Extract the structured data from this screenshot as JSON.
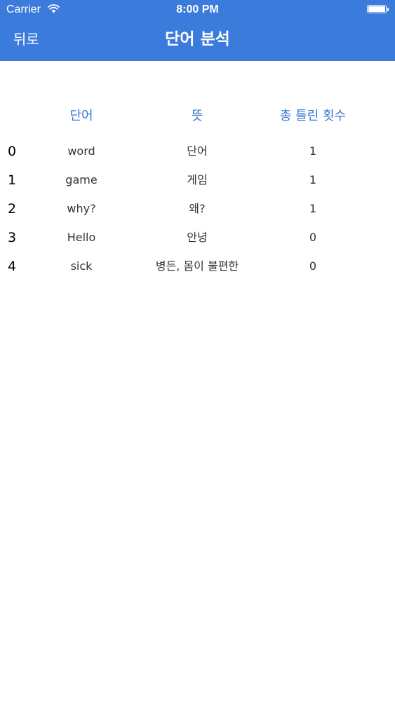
{
  "status_bar": {
    "carrier": "Carrier",
    "time": "8:00 PM",
    "battery_level": 1.0
  },
  "nav": {
    "back_label": "뒤로",
    "title": "단어 분석"
  },
  "table": {
    "headers": {
      "word": "단어",
      "meaning": "뜻",
      "wrong_count": "총 틀린 횟수"
    },
    "rows": [
      {
        "index": "0",
        "word": "word",
        "meaning": "단어",
        "wrong_count": "1"
      },
      {
        "index": "1",
        "word": "game",
        "meaning": "게임",
        "wrong_count": "1"
      },
      {
        "index": "2",
        "word": "why?",
        "meaning": "왜?",
        "wrong_count": "1"
      },
      {
        "index": "3",
        "word": "Hello",
        "meaning": "안녕",
        "wrong_count": "0"
      },
      {
        "index": "4",
        "word": "sick",
        "meaning": "병든, 몸이 불편한",
        "wrong_count": "0"
      }
    ]
  },
  "colors": {
    "nav_background": "#3b7bdb",
    "header_text": "#3a78cf"
  },
  "icons": {
    "wifi": "wifi-icon",
    "battery": "battery-icon"
  }
}
